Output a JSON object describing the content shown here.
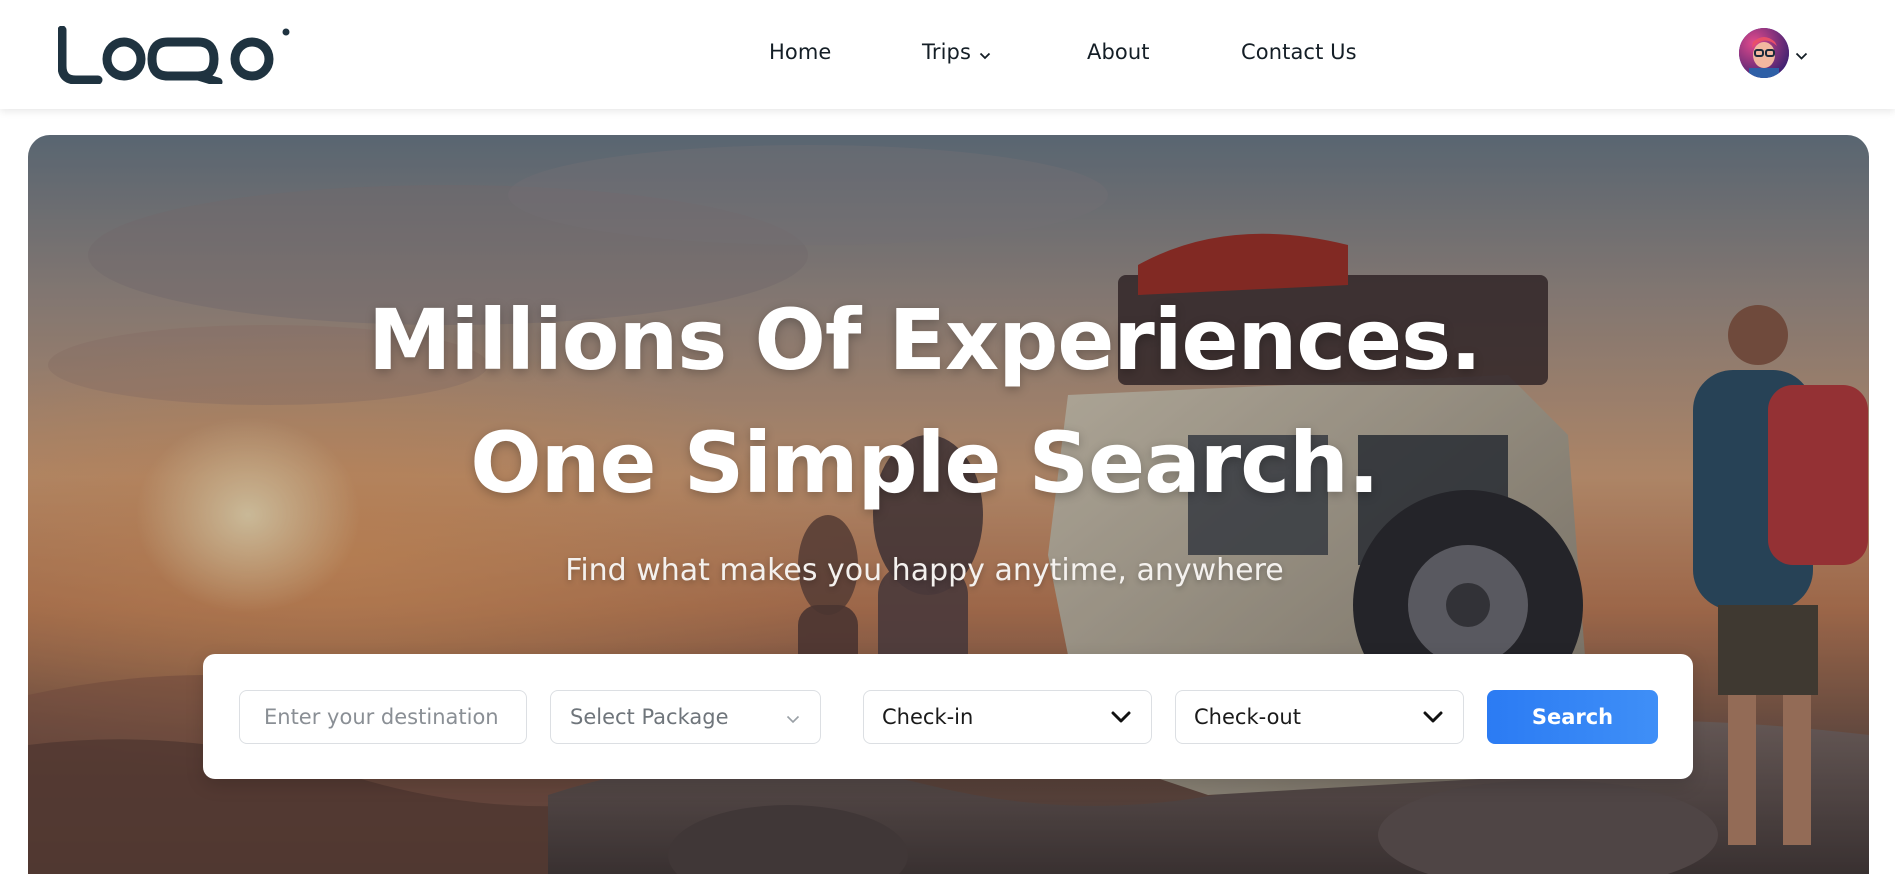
{
  "brand": {
    "logo_text": "LOQO",
    "primary_color": "#1f3340"
  },
  "nav": {
    "items": [
      {
        "label": "Home"
      },
      {
        "label": "Trips",
        "has_dropdown": true
      },
      {
        "label": "About"
      },
      {
        "label": "Contact Us"
      }
    ]
  },
  "user": {
    "avatar_icon": "user-avatar",
    "menu_icon": "chevron-down-icon"
  },
  "hero": {
    "title_line1": "Millions Of Experiences.",
    "title_line2": "One Simple Search.",
    "subtitle": "Find what makes you happy anytime, anywhere",
    "background_icon": "hikers-with-jeep-at-sunset-photo"
  },
  "search": {
    "destination_placeholder": "Enter your destination",
    "package_label": "Select Package",
    "checkin_label": "Check-in",
    "checkout_label": "Check-out",
    "button_label": "Search",
    "button_color": "#2f80f5"
  }
}
